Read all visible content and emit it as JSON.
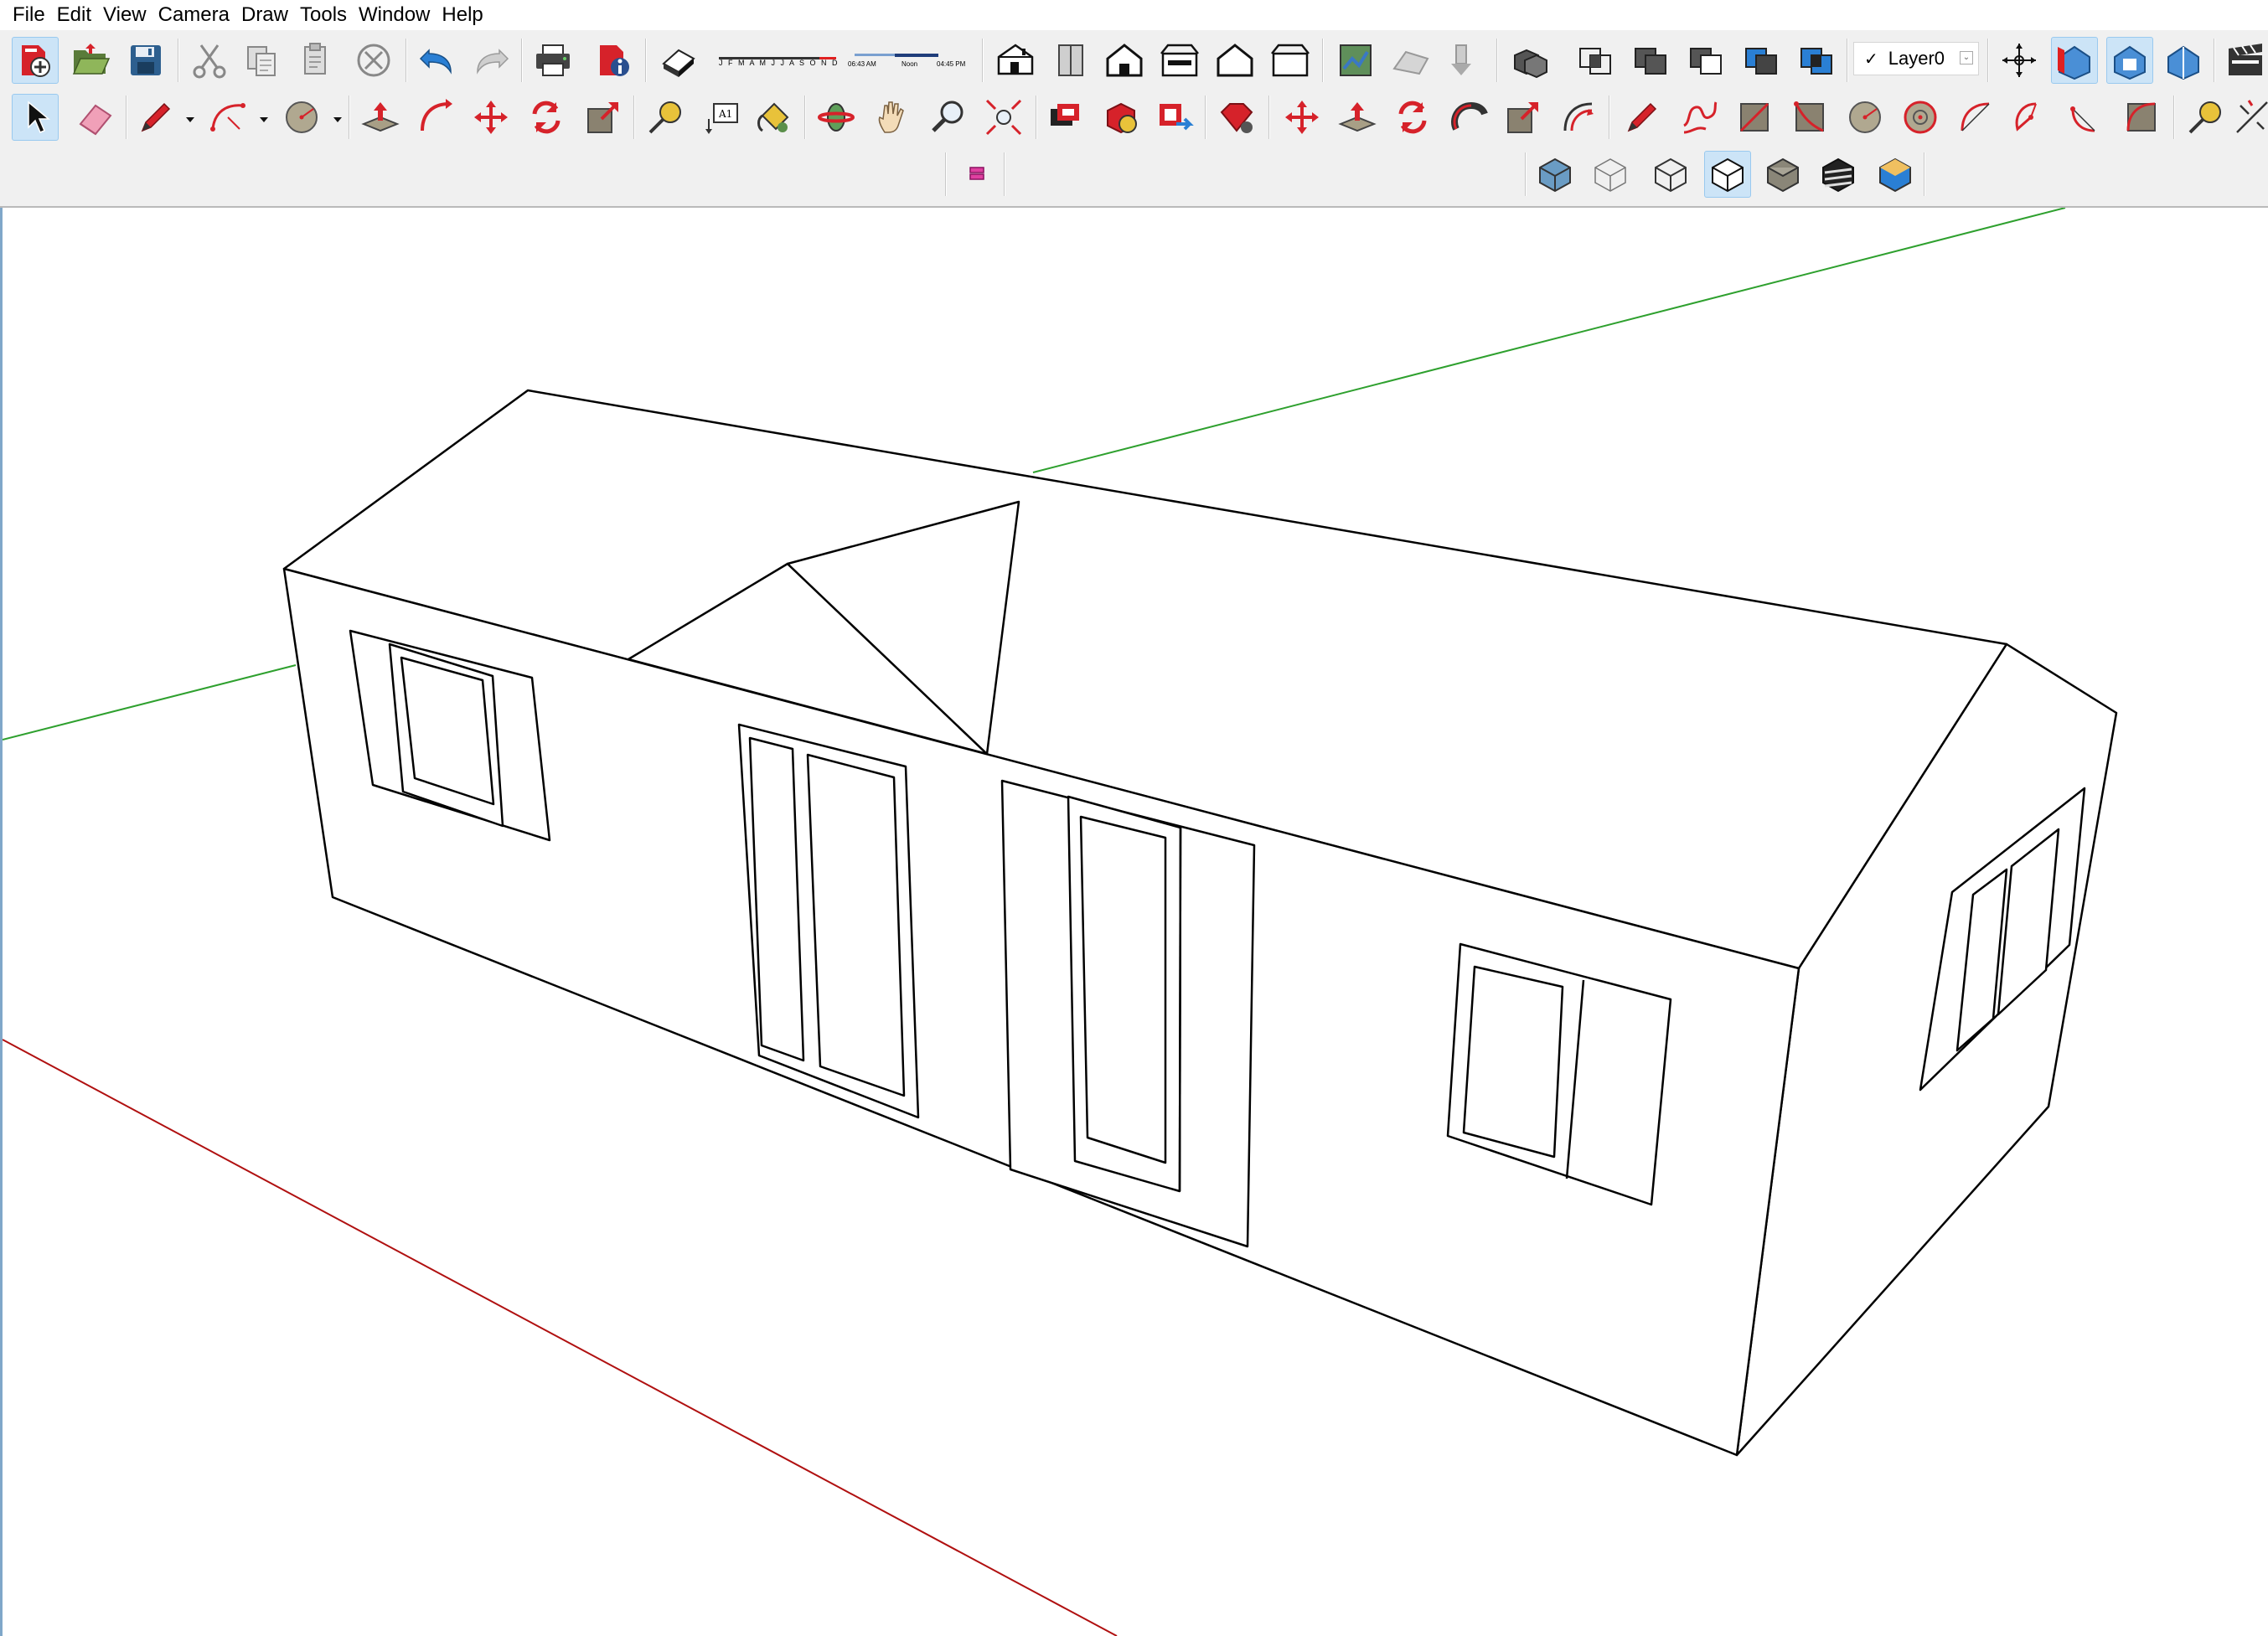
{
  "menu": {
    "file": "File",
    "edit": "Edit",
    "view": "View",
    "camera": "Camera",
    "draw": "Draw",
    "tools": "Tools",
    "window": "Window",
    "help": "Help"
  },
  "shadow": {
    "months": "J F M A M J J A S O N D",
    "time_start": "06:43 AM",
    "time_noon": "Noon",
    "time_end": "04:45 PM"
  },
  "layer": {
    "current": "Layer0",
    "checked": true
  },
  "toolbar": {
    "row1_icons": [
      "new-file-icon",
      "open-folder-icon",
      "save-icon",
      "cut-icon",
      "copy-icon",
      "paste-icon",
      "erase-circle-icon",
      "undo-icon",
      "redo-icon",
      "print-icon",
      "model-info-icon",
      "shadows-toggle-icon",
      "iso-view-icon",
      "top-view-icon",
      "front-view-icon",
      "right-view-icon",
      "back-view-icon",
      "left-view-icon",
      "geolocation-icon",
      "terrain-icon",
      "photo-texture-icon",
      "outer-shell-icon",
      "intersect-icon",
      "union-icon",
      "subtract-icon",
      "trim-icon",
      "split-icon",
      "axes-icon",
      "section-plane-icon",
      "section-cut-icon",
      "section-display-icon",
      "scene-icon"
    ],
    "row2_icons": [
      "select-icon",
      "eraser-icon",
      "pencil-icon",
      "arc-icon",
      "circle-icon",
      "push-pull-icon",
      "follow-me-icon",
      "move-icon",
      "rotate-icon",
      "scale-icon",
      "tape-measure-icon",
      "text-icon",
      "paint-bucket-icon",
      "orbit-icon",
      "pan-icon",
      "zoom-icon",
      "zoom-extents-icon",
      "warehouse-icon",
      "share-model-icon",
      "extension-warehouse-icon",
      "ruby-icon",
      "move-red-icon",
      "push-pull-red-icon",
      "rotate-red-icon",
      "follow-me-red-icon",
      "scale-red-icon",
      "offset-red-icon",
      "line-icon",
      "freehand-icon",
      "rectangle-icon",
      "rotated-rectangle-icon",
      "circle-red-icon",
      "polygon-icon",
      "arc-red-icon",
      "pie-icon",
      "two-point-arc-icon",
      "three-point-arc-icon",
      "tape-measure-2-icon",
      "dimension-icon"
    ],
    "row3_icons": [
      "layers-icon",
      "xray-style-icon",
      "wireframe-style-icon",
      "hidden-line-style-icon",
      "shaded-style-icon",
      "shaded-texture-style-icon",
      "monochrome-style-icon",
      "hidden-geometry-style-icon"
    ]
  },
  "colors": {
    "toolbar_bg": "#f0f0f0",
    "active_bg": "#cce4f7",
    "green_axis": "#2ea02e",
    "red_axis": "#b01010",
    "edge": "#000000",
    "icon_red": "#d6222a",
    "icon_blue": "#2a7fd4"
  }
}
